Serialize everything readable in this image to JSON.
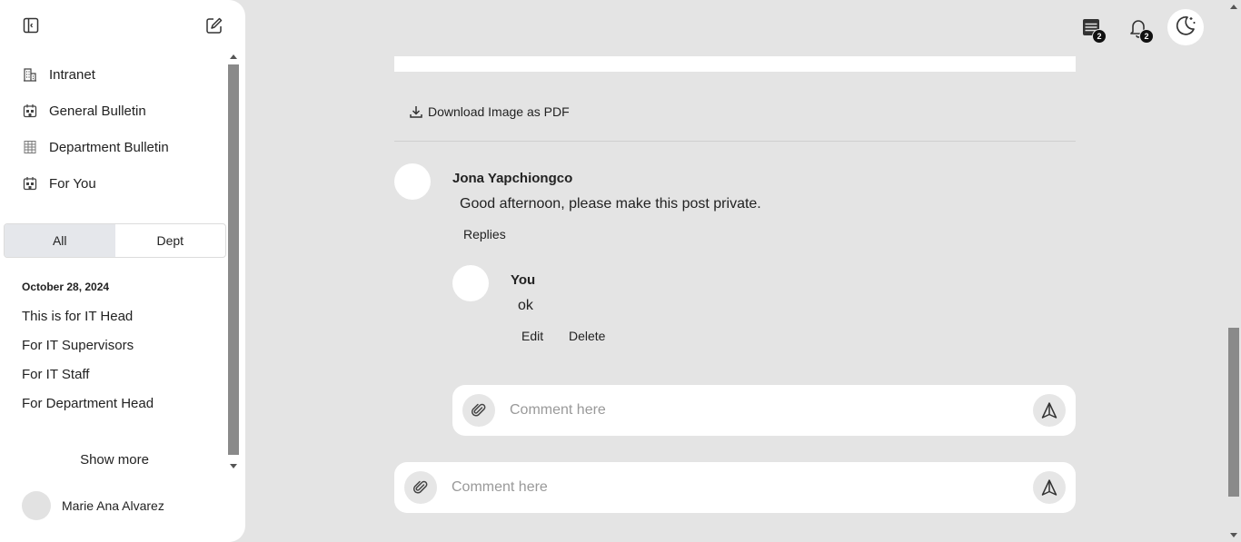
{
  "sidebar": {
    "nav_items": [
      {
        "label": "Intranet",
        "icon": "building-icon"
      },
      {
        "label": "General Bulletin",
        "icon": "calendar-building-icon"
      },
      {
        "label": "Department Bulletin",
        "icon": "grid-building-icon"
      },
      {
        "label": "For You",
        "icon": "calendar-building-icon"
      }
    ],
    "tabs": [
      {
        "label": "All",
        "active": true
      },
      {
        "label": "Dept",
        "active": false
      }
    ],
    "date_heading": "October 28, 2024",
    "posts": [
      "This is for IT Head",
      "For IT Supervisors",
      "For IT Staff",
      "For Department Head"
    ],
    "show_more": "Show more",
    "user_name": "Marie Ana Alvarez"
  },
  "header": {
    "messages_count": "2",
    "notifications_count": "2"
  },
  "post": {
    "download_label": "Download Image as PDF"
  },
  "comments": [
    {
      "author": "Jona Yapchiongco",
      "text": "Good afternoon, please make this post private.",
      "replies_label": "Replies",
      "replies": [
        {
          "author": "You",
          "text": "ok",
          "edit_label": "Edit",
          "delete_label": "Delete"
        }
      ]
    }
  ],
  "reply_input": {
    "placeholder": "Comment here"
  },
  "comment_input": {
    "placeholder": "Comment here"
  },
  "colors": {
    "background": "#e4e4e4",
    "surface": "#ffffff",
    "active_tab": "#e5e7eb"
  }
}
